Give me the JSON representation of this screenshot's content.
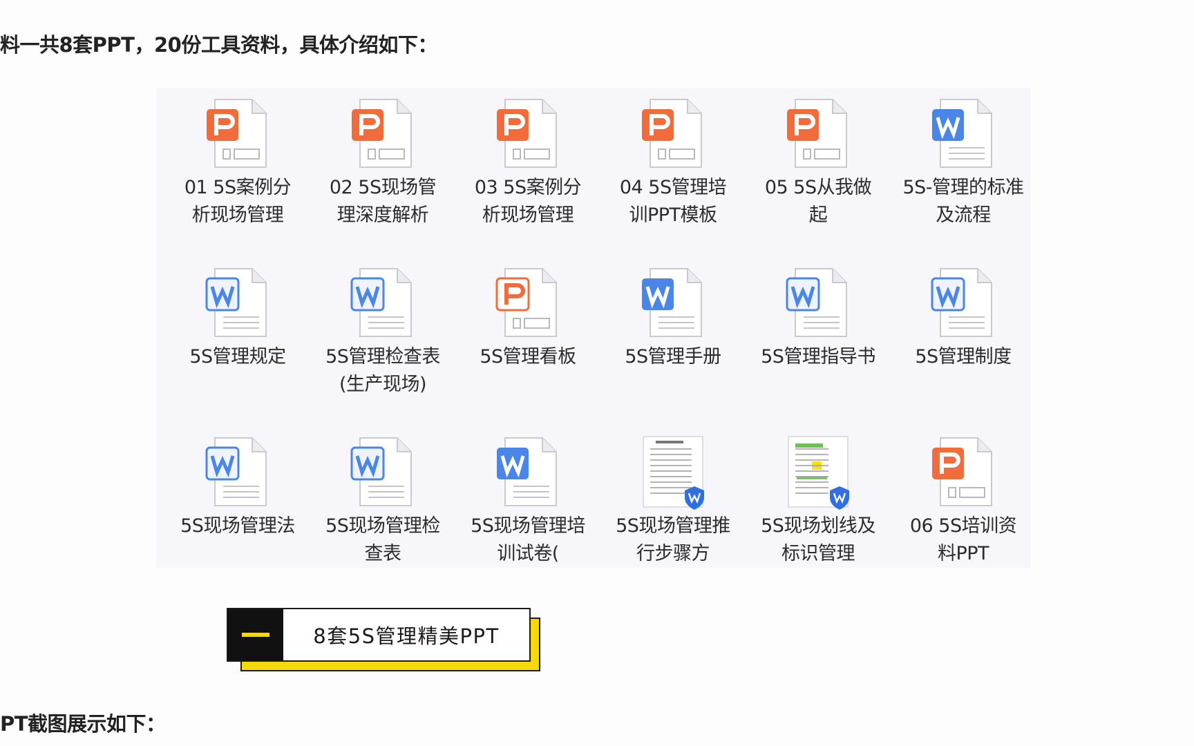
{
  "intro_text": "料一共8套PPT，20份工具资料，具体介绍如下：",
  "files": [
    {
      "name": "01 5S案例分析现场管理",
      "type": "ppt"
    },
    {
      "name": "02 5S现场管理深度解析",
      "type": "ppt"
    },
    {
      "name": "03 5S案例分析现场管理",
      "type": "ppt"
    },
    {
      "name": "04 5S管理培训PPT模板",
      "type": "ppt"
    },
    {
      "name": "05 5S从我做起",
      "type": "ppt"
    },
    {
      "name": "5S-管理的标准及流程",
      "type": "word"
    },
    {
      "name": "5S管理规定",
      "type": "word-light"
    },
    {
      "name": "5S管理检查表(生产现场)",
      "type": "word-light"
    },
    {
      "name": "5S管理看板",
      "type": "ppt-light"
    },
    {
      "name": "5S管理手册",
      "type": "word"
    },
    {
      "name": "5S管理指导书",
      "type": "word-light"
    },
    {
      "name": "5S管理制度",
      "type": "word-light"
    },
    {
      "name": "5S现场管理法",
      "type": "word-light"
    },
    {
      "name": "5S现场管理检查表",
      "type": "word-light"
    },
    {
      "name": "5S现场管理培训试卷(",
      "type": "word"
    },
    {
      "name": "5S现场管理推行步骤方",
      "type": "doc-thumb"
    },
    {
      "name": "5S现场划线及标识管理",
      "type": "doc-thumb-color"
    },
    {
      "name": "06 5S培训资料PPT",
      "type": "ppt"
    }
  ],
  "section_header": {
    "number": "一",
    "title": "8套5S管理精美PPT"
  },
  "outro_text": "PT截图展示如下：",
  "colors": {
    "ppt_orange": "#f26b3a",
    "word_blue": "#4a86e8",
    "header_yellow": "#f5d90a"
  },
  "icons": {
    "ppt": "ppt-file-icon",
    "word": "word-file-icon",
    "thumb": "document-thumbnail-icon"
  }
}
